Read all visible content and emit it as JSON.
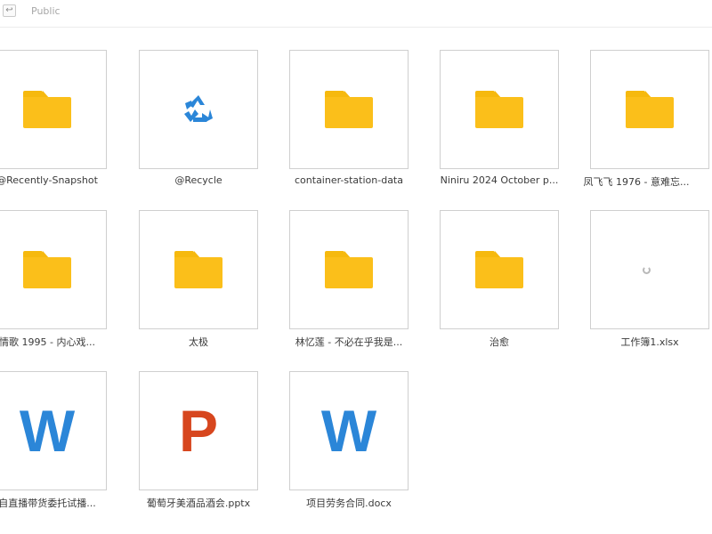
{
  "header": {
    "back_icon": "back-arrow-icon",
    "breadcrumb": "Public"
  },
  "files": [
    {
      "name": "@Recently-Snapshot",
      "icon": "folder-icon"
    },
    {
      "name": "@Recycle",
      "icon": "recycle-icon"
    },
    {
      "name": "container-station-data",
      "icon": "folder-icon"
    },
    {
      "name": "Niniru 2024 October p...",
      "icon": "folder-icon"
    },
    {
      "name": "凤飞飞 1976 - 意难忘...",
      "icon": "folder-icon"
    },
    {
      "name": "情歌 1995 - 内心戏...",
      "icon": "folder-icon"
    },
    {
      "name": "太极",
      "icon": "folder-icon"
    },
    {
      "name": "林忆莲 - 不必在乎我是...",
      "icon": "folder-icon"
    },
    {
      "name": "治愈",
      "icon": "folder-icon"
    },
    {
      "name": "工作簿1.xlsx",
      "icon": "loading-spinner-icon"
    },
    {
      "name": "自直播带货委托试播...",
      "icon": "word-doc-icon"
    },
    {
      "name": "葡萄牙美酒品酒会.pptx",
      "icon": "powerpoint-icon"
    },
    {
      "name": "项目劳务合同.docx",
      "icon": "word-doc-icon"
    }
  ],
  "colors": {
    "folder": "#fbbf1a",
    "recycle": "#2b86d8",
    "word": "#2b86d8",
    "powerpoint": "#d7461e"
  }
}
